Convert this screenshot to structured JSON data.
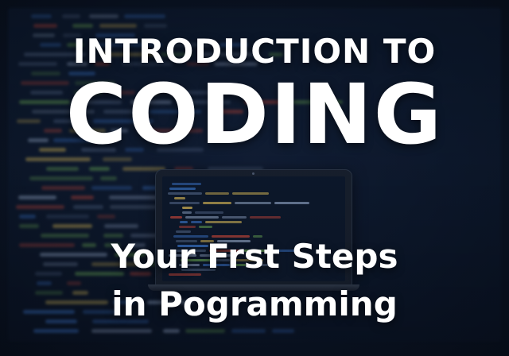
{
  "poster": {
    "heading_line1": "INTRODUCTION TO",
    "heading_line2": "CODING",
    "subtitle_line1": "Your Frst Steps",
    "subtitle_line2": "in Pogramming"
  },
  "colors": {
    "background": "#0b1322",
    "text": "#ffffff",
    "code_red": "#c2483d",
    "code_blue": "#3e7bd6",
    "code_green": "#6fb05a",
    "code_yellow": "#d6b85a"
  },
  "icons": {
    "laptop": "laptop-icon"
  }
}
